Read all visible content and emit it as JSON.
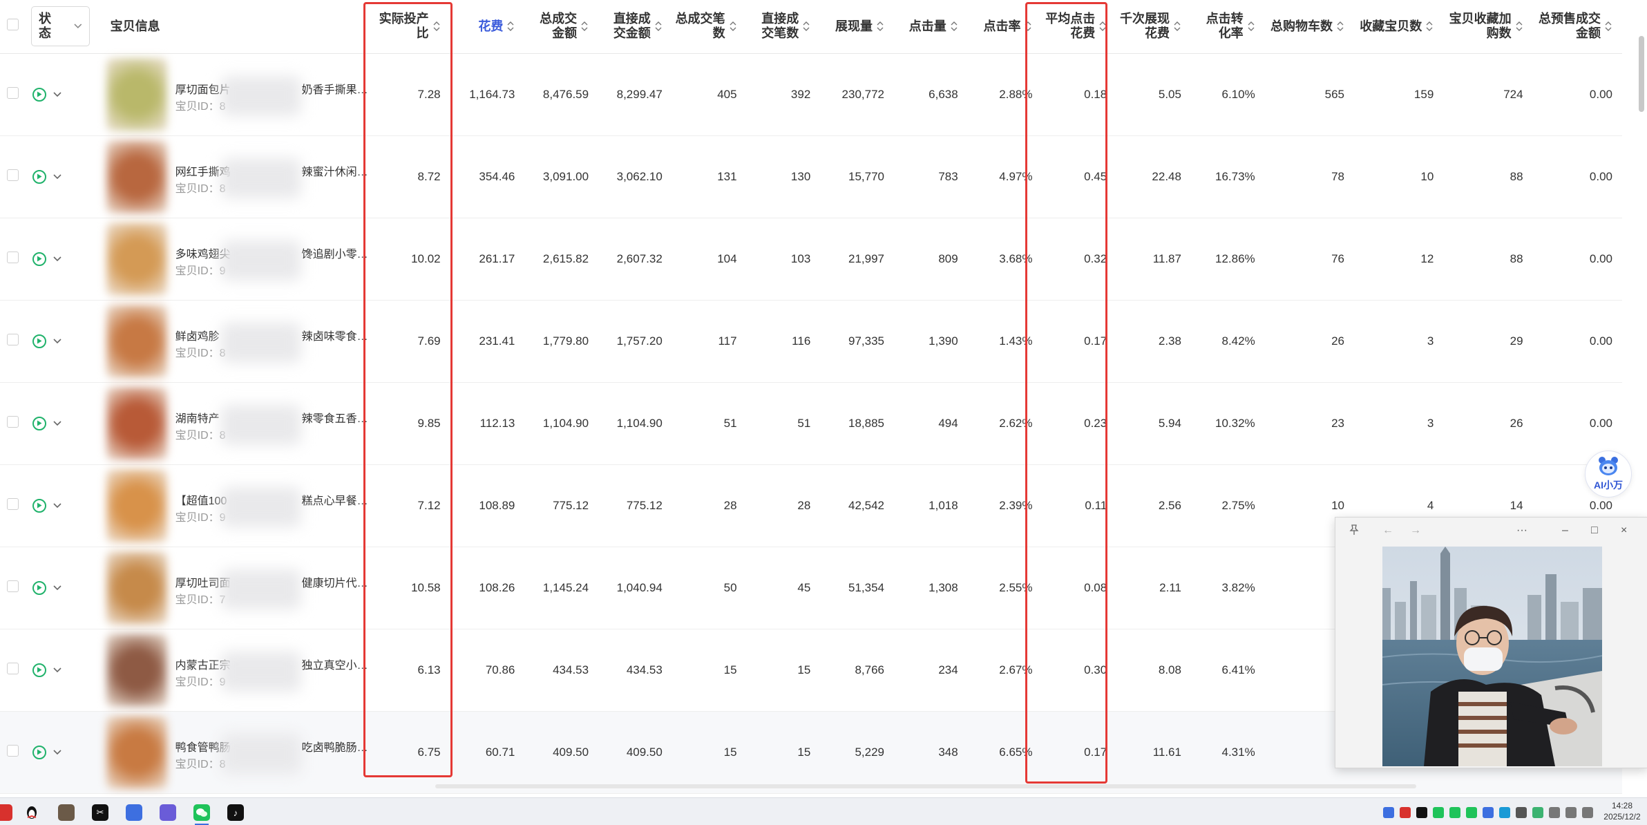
{
  "table": {
    "status_label": "状态",
    "item_label": "宝贝信息",
    "columns": [
      {
        "key": "roi",
        "label": "实际投产比"
      },
      {
        "key": "cost",
        "label": "花费"
      },
      {
        "key": "gmv",
        "label": "总成交金额"
      },
      {
        "key": "direct_gmv",
        "label": "直接成交金额"
      },
      {
        "key": "orders",
        "label": "总成交笔数"
      },
      {
        "key": "direct_orders",
        "label": "直接成交笔数"
      },
      {
        "key": "impressions",
        "label": "展现量"
      },
      {
        "key": "clicks",
        "label": "点击量"
      },
      {
        "key": "ctr",
        "label": "点击率"
      },
      {
        "key": "cpc",
        "label": "平均点击花费"
      },
      {
        "key": "cpm",
        "label": "千次展现花费"
      },
      {
        "key": "cvr",
        "label": "点击转化率"
      },
      {
        "key": "cart",
        "label": "总购物车数"
      },
      {
        "key": "fav",
        "label": "收藏宝贝数"
      },
      {
        "key": "fav_cart",
        "label": "宝贝收藏加购数"
      },
      {
        "key": "presale",
        "label": "总预售成交金额"
      }
    ],
    "rows": [
      {
        "name": "厚切面包片",
        "id": "宝贝ID：8",
        "suffix": "奶香手撕果…",
        "roi": "7.28",
        "cost": "1,164.73",
        "gmv": "8,476.59",
        "direct_gmv": "8,299.47",
        "orders": "405",
        "direct_orders": "392",
        "impressions": "230,772",
        "clicks": "6,638",
        "ctr": "2.88%",
        "cpc": "0.18",
        "cpm": "5.05",
        "cvr": "6.10%",
        "cart": "565",
        "fav": "159",
        "fav_cart": "724",
        "presale": "0.00"
      },
      {
        "name": "网红手撕鸡",
        "id": "宝贝ID：8",
        "suffix": "辣蜜汁休闲…",
        "roi": "8.72",
        "cost": "354.46",
        "gmv": "3,091.00",
        "direct_gmv": "3,062.10",
        "orders": "131",
        "direct_orders": "130",
        "impressions": "15,770",
        "clicks": "783",
        "ctr": "4.97%",
        "cpc": "0.45",
        "cpm": "22.48",
        "cvr": "16.73%",
        "cart": "78",
        "fav": "10",
        "fav_cart": "88",
        "presale": "0.00"
      },
      {
        "name": "多味鸡翅尖",
        "id": "宝贝ID：9",
        "suffix": "馋追剧小零…",
        "roi": "10.02",
        "cost": "261.17",
        "gmv": "2,615.82",
        "direct_gmv": "2,607.32",
        "orders": "104",
        "direct_orders": "103",
        "impressions": "21,997",
        "clicks": "809",
        "ctr": "3.68%",
        "cpc": "0.32",
        "cpm": "11.87",
        "cvr": "12.86%",
        "cart": "76",
        "fav": "12",
        "fav_cart": "88",
        "presale": "0.00"
      },
      {
        "name": "鲜卤鸡胗",
        "id": "宝贝ID：8",
        "suffix": "辣卤味零食…",
        "roi": "7.69",
        "cost": "231.41",
        "gmv": "1,779.80",
        "direct_gmv": "1,757.20",
        "orders": "117",
        "direct_orders": "116",
        "impressions": "97,335",
        "clicks": "1,390",
        "ctr": "1.43%",
        "cpc": "0.17",
        "cpm": "2.38",
        "cvr": "8.42%",
        "cart": "26",
        "fav": "3",
        "fav_cart": "29",
        "presale": "0.00"
      },
      {
        "name": "湖南特产",
        "id": "宝贝ID：8",
        "suffix": "辣零食五香…",
        "roi": "9.85",
        "cost": "112.13",
        "gmv": "1,104.90",
        "direct_gmv": "1,104.90",
        "orders": "51",
        "direct_orders": "51",
        "impressions": "18,885",
        "clicks": "494",
        "ctr": "2.62%",
        "cpc": "0.23",
        "cpm": "5.94",
        "cvr": "10.32%",
        "cart": "23",
        "fav": "3",
        "fav_cart": "26",
        "presale": "0.00"
      },
      {
        "name": "【超值100",
        "id": "宝贝ID：9",
        "suffix": "糕点心早餐…",
        "roi": "7.12",
        "cost": "108.89",
        "gmv": "775.12",
        "direct_gmv": "775.12",
        "orders": "28",
        "direct_orders": "28",
        "impressions": "42,542",
        "clicks": "1,018",
        "ctr": "2.39%",
        "cpc": "0.11",
        "cpm": "2.56",
        "cvr": "2.75%",
        "cart": "10",
        "fav": "4",
        "fav_cart": "14",
        "presale": "0.00"
      },
      {
        "name": "厚切吐司面",
        "id": "宝贝ID：7",
        "suffix": "健康切片代…",
        "roi": "10.58",
        "cost": "108.26",
        "gmv": "1,145.24",
        "direct_gmv": "1,040.94",
        "orders": "50",
        "direct_orders": "45",
        "impressions": "51,354",
        "clicks": "1,308",
        "ctr": "2.55%",
        "cpc": "0.08",
        "cpm": "2.11",
        "cvr": "3.82%",
        "cart": "",
        "fav": "",
        "fav_cart": "",
        "presale": ""
      },
      {
        "name": "内蒙古正宗",
        "id": "宝贝ID：9",
        "suffix": "独立真空小…",
        "roi": "6.13",
        "cost": "70.86",
        "gmv": "434.53",
        "direct_gmv": "434.53",
        "orders": "15",
        "direct_orders": "15",
        "impressions": "8,766",
        "clicks": "234",
        "ctr": "2.67%",
        "cpc": "0.30",
        "cpm": "8.08",
        "cvr": "6.41%",
        "cart": "",
        "fav": "",
        "fav_cart": "",
        "presale": ""
      },
      {
        "name": "鸭食管鸭肠",
        "id": "宝贝ID：8",
        "suffix": "吃卤鸭脆肠…",
        "roi": "6.75",
        "cost": "60.71",
        "gmv": "409.50",
        "direct_gmv": "409.50",
        "orders": "15",
        "direct_orders": "15",
        "impressions": "5,229",
        "clicks": "348",
        "ctr": "6.65%",
        "cpc": "0.17",
        "cpm": "11.61",
        "cvr": "4.31%",
        "cart": "",
        "fav": "",
        "fav_cart": "",
        "presale": ""
      }
    ]
  },
  "ai_assistant": {
    "label": "AI小万"
  },
  "viewer": {
    "pin_icon": "pin-icon",
    "more": "···",
    "min": "–",
    "max": "□",
    "close": "×"
  },
  "taskbar": {
    "time": "14:28",
    "date": "2025/12/2"
  },
  "colors": {
    "highlight_box": "#e53935",
    "accent_blue": "#3b5bdb",
    "status_green": "#20b26b"
  }
}
